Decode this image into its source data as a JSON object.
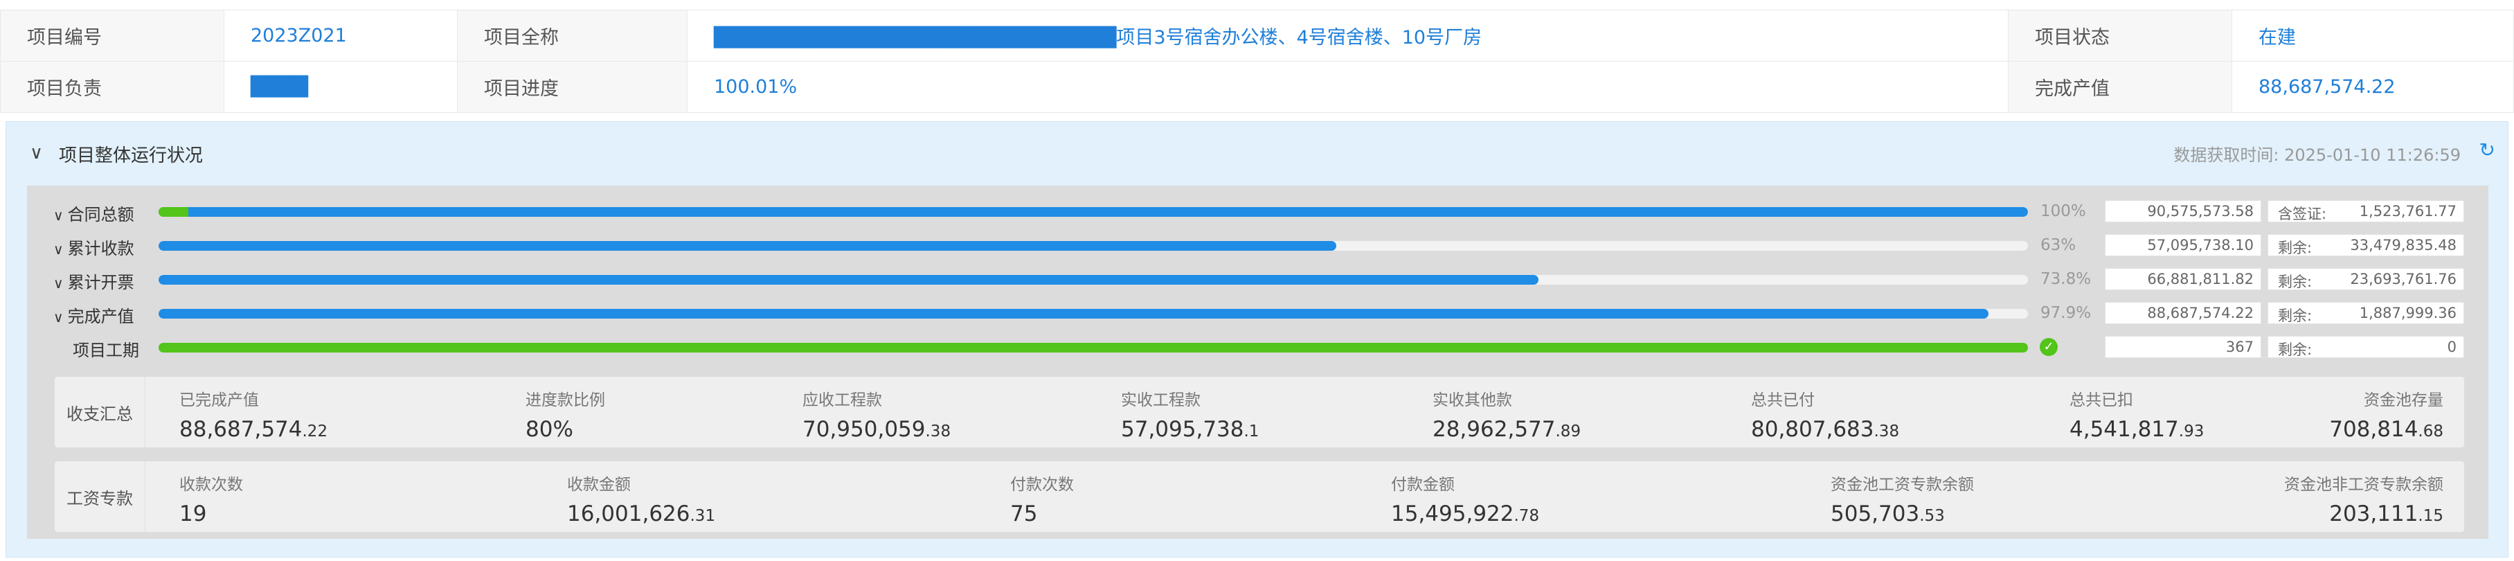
{
  "info": {
    "project_code_label": "项目编号",
    "project_code": "2023Z021",
    "project_name_label": "项目全称",
    "project_name": "████████████████████████████项目3号宿舍办公楼、4号宿舍楼、10号厂房",
    "status_label": "项目状态",
    "status": "在建",
    "manager_label": "项目负责",
    "manager": "████",
    "progress_label": "项目进度",
    "progress": "100.01%",
    "output_label": "完成产值",
    "output": "88,687,574.22"
  },
  "panel": {
    "title": "项目整体运行状况",
    "fetch_time": "数据获取时间: 2025-01-10 11:26:59",
    "icons": {
      "collapse": "chevron-down-icon",
      "refresh": "refresh-icon",
      "done": "check-circle-icon"
    },
    "colors": {
      "accent": "#1f8ce6",
      "green": "#52c41a"
    }
  },
  "rows": [
    {
      "label": "合同总额",
      "pct_text": "100%",
      "fraction": 1.0,
      "green_fraction": 0.016,
      "total": "90,575,573.58",
      "side_key": "含签证:",
      "side_val": "1,523,761.77"
    },
    {
      "label": "累计收款",
      "pct_text": "63%",
      "fraction": 0.63,
      "total": "57,095,738.10",
      "side_key": "剩余:",
      "side_val": "33,479,835.48"
    },
    {
      "label": "累计开票",
      "pct_text": "73.8%",
      "fraction": 0.738,
      "total": "66,881,811.82",
      "side_key": "剩余:",
      "side_val": "23,693,761.76"
    },
    {
      "label": "完成产值",
      "pct_text": "97.9%",
      "fraction": 0.979,
      "total": "88,687,574.22",
      "side_key": "剩余:",
      "side_val": "1,887,999.36"
    },
    {
      "label": "项目工期",
      "fraction": 1.0,
      "total": "367",
      "side_key": "剩余:",
      "side_val": "0"
    }
  ],
  "income_summary": {
    "title": "收支汇总",
    "items": [
      {
        "label": "已完成产值",
        "int": "88,687,574",
        "dec": ".22"
      },
      {
        "label": "进度款比例",
        "int": "80%",
        "dec": ""
      },
      {
        "label": "应收工程款",
        "int": "70,950,059",
        "dec": ".38"
      },
      {
        "label": "实收工程款",
        "int": "57,095,738",
        "dec": ".1"
      },
      {
        "label": "实收其他款",
        "int": "28,962,577",
        "dec": ".89"
      },
      {
        "label": "总共已付",
        "int": "80,807,683",
        "dec": ".38"
      },
      {
        "label": "总共已扣",
        "int": "4,541,817",
        "dec": ".93"
      },
      {
        "label": "资金池存量",
        "int": "708,814",
        "dec": ".68"
      }
    ]
  },
  "wage_account": {
    "title": "工资专款",
    "items": [
      {
        "label": "收款次数",
        "int": "19",
        "dec": ""
      },
      {
        "label": "收款金额",
        "int": "16,001,626",
        "dec": ".31"
      },
      {
        "label": "付款次数",
        "int": "75",
        "dec": ""
      },
      {
        "label": "付款金额",
        "int": "15,495,922",
        "dec": ".78"
      },
      {
        "label": "资金池工资专款余额",
        "int": "505,703",
        "dec": ".53"
      },
      {
        "label": "资金池非工资专款余额",
        "int": "203,111",
        "dec": ".15"
      }
    ]
  }
}
